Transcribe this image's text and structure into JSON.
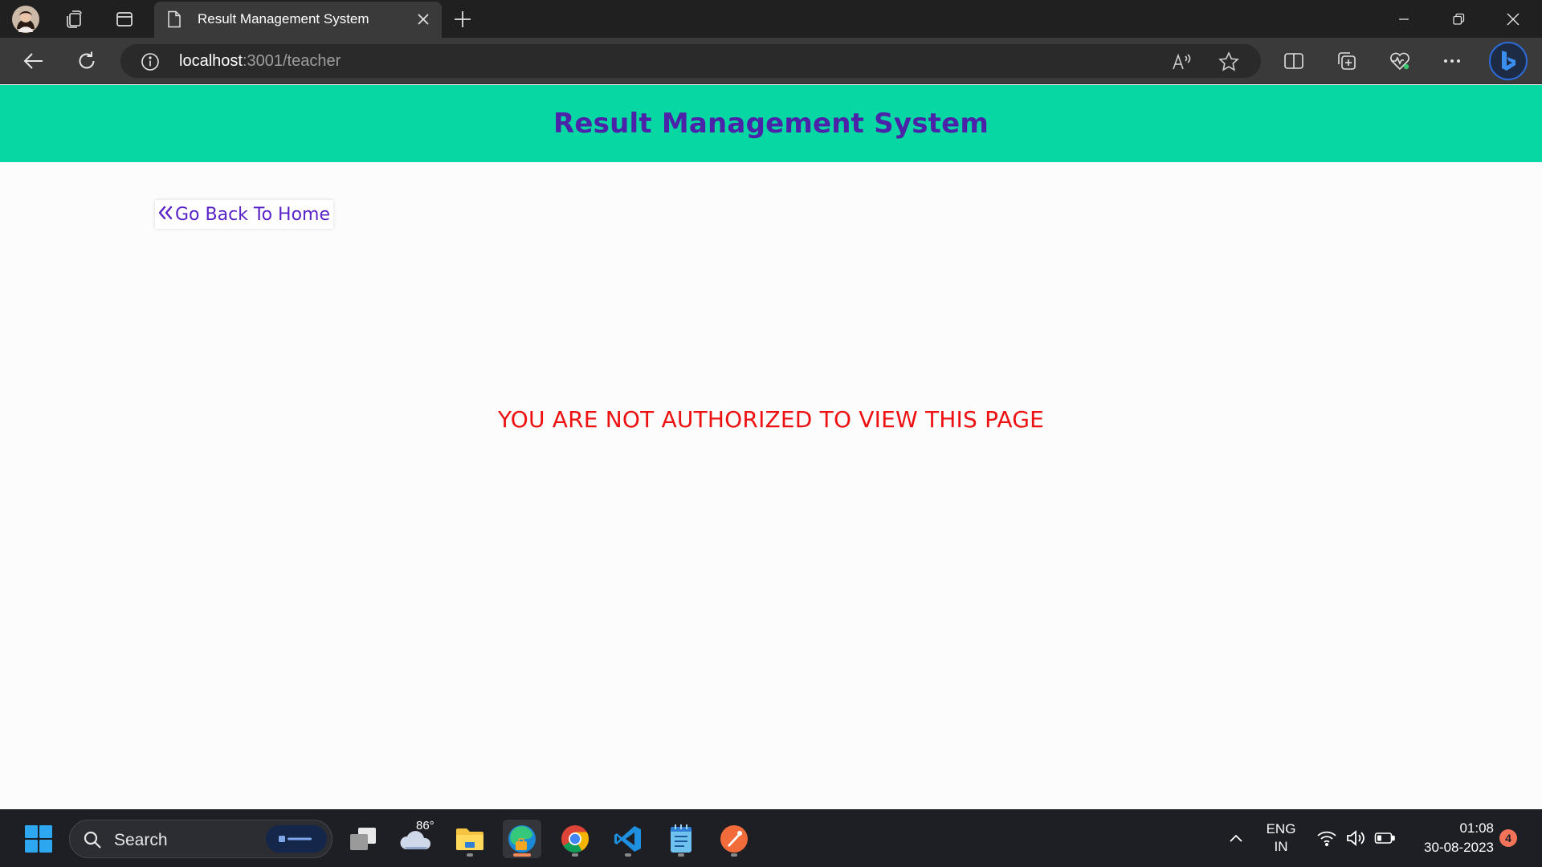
{
  "browser": {
    "tab_title": "Result Management System",
    "url_host": "localhost",
    "url_path": ":3001/teacher"
  },
  "app": {
    "title": "Result Management System",
    "back_link_label": "Go Back To Home",
    "message": "YOU ARE NOT AUTHORIZED TO VIEW THIS PAGE"
  },
  "taskbar": {
    "search_placeholder": "Search",
    "weather_temp": "86°",
    "pinned_apps": [
      "file-explorer",
      "edge",
      "chrome",
      "vscode",
      "notepad",
      "postman"
    ]
  },
  "tray": {
    "language": "ENG",
    "region": "IN",
    "time": "01:08",
    "date": "30-08-2023",
    "notification_count": "4"
  },
  "colors": {
    "header_bg": "#07d7a2",
    "title_color": "#4b22a8",
    "link_color": "#5a23c8",
    "error_color": "#ee1111"
  }
}
